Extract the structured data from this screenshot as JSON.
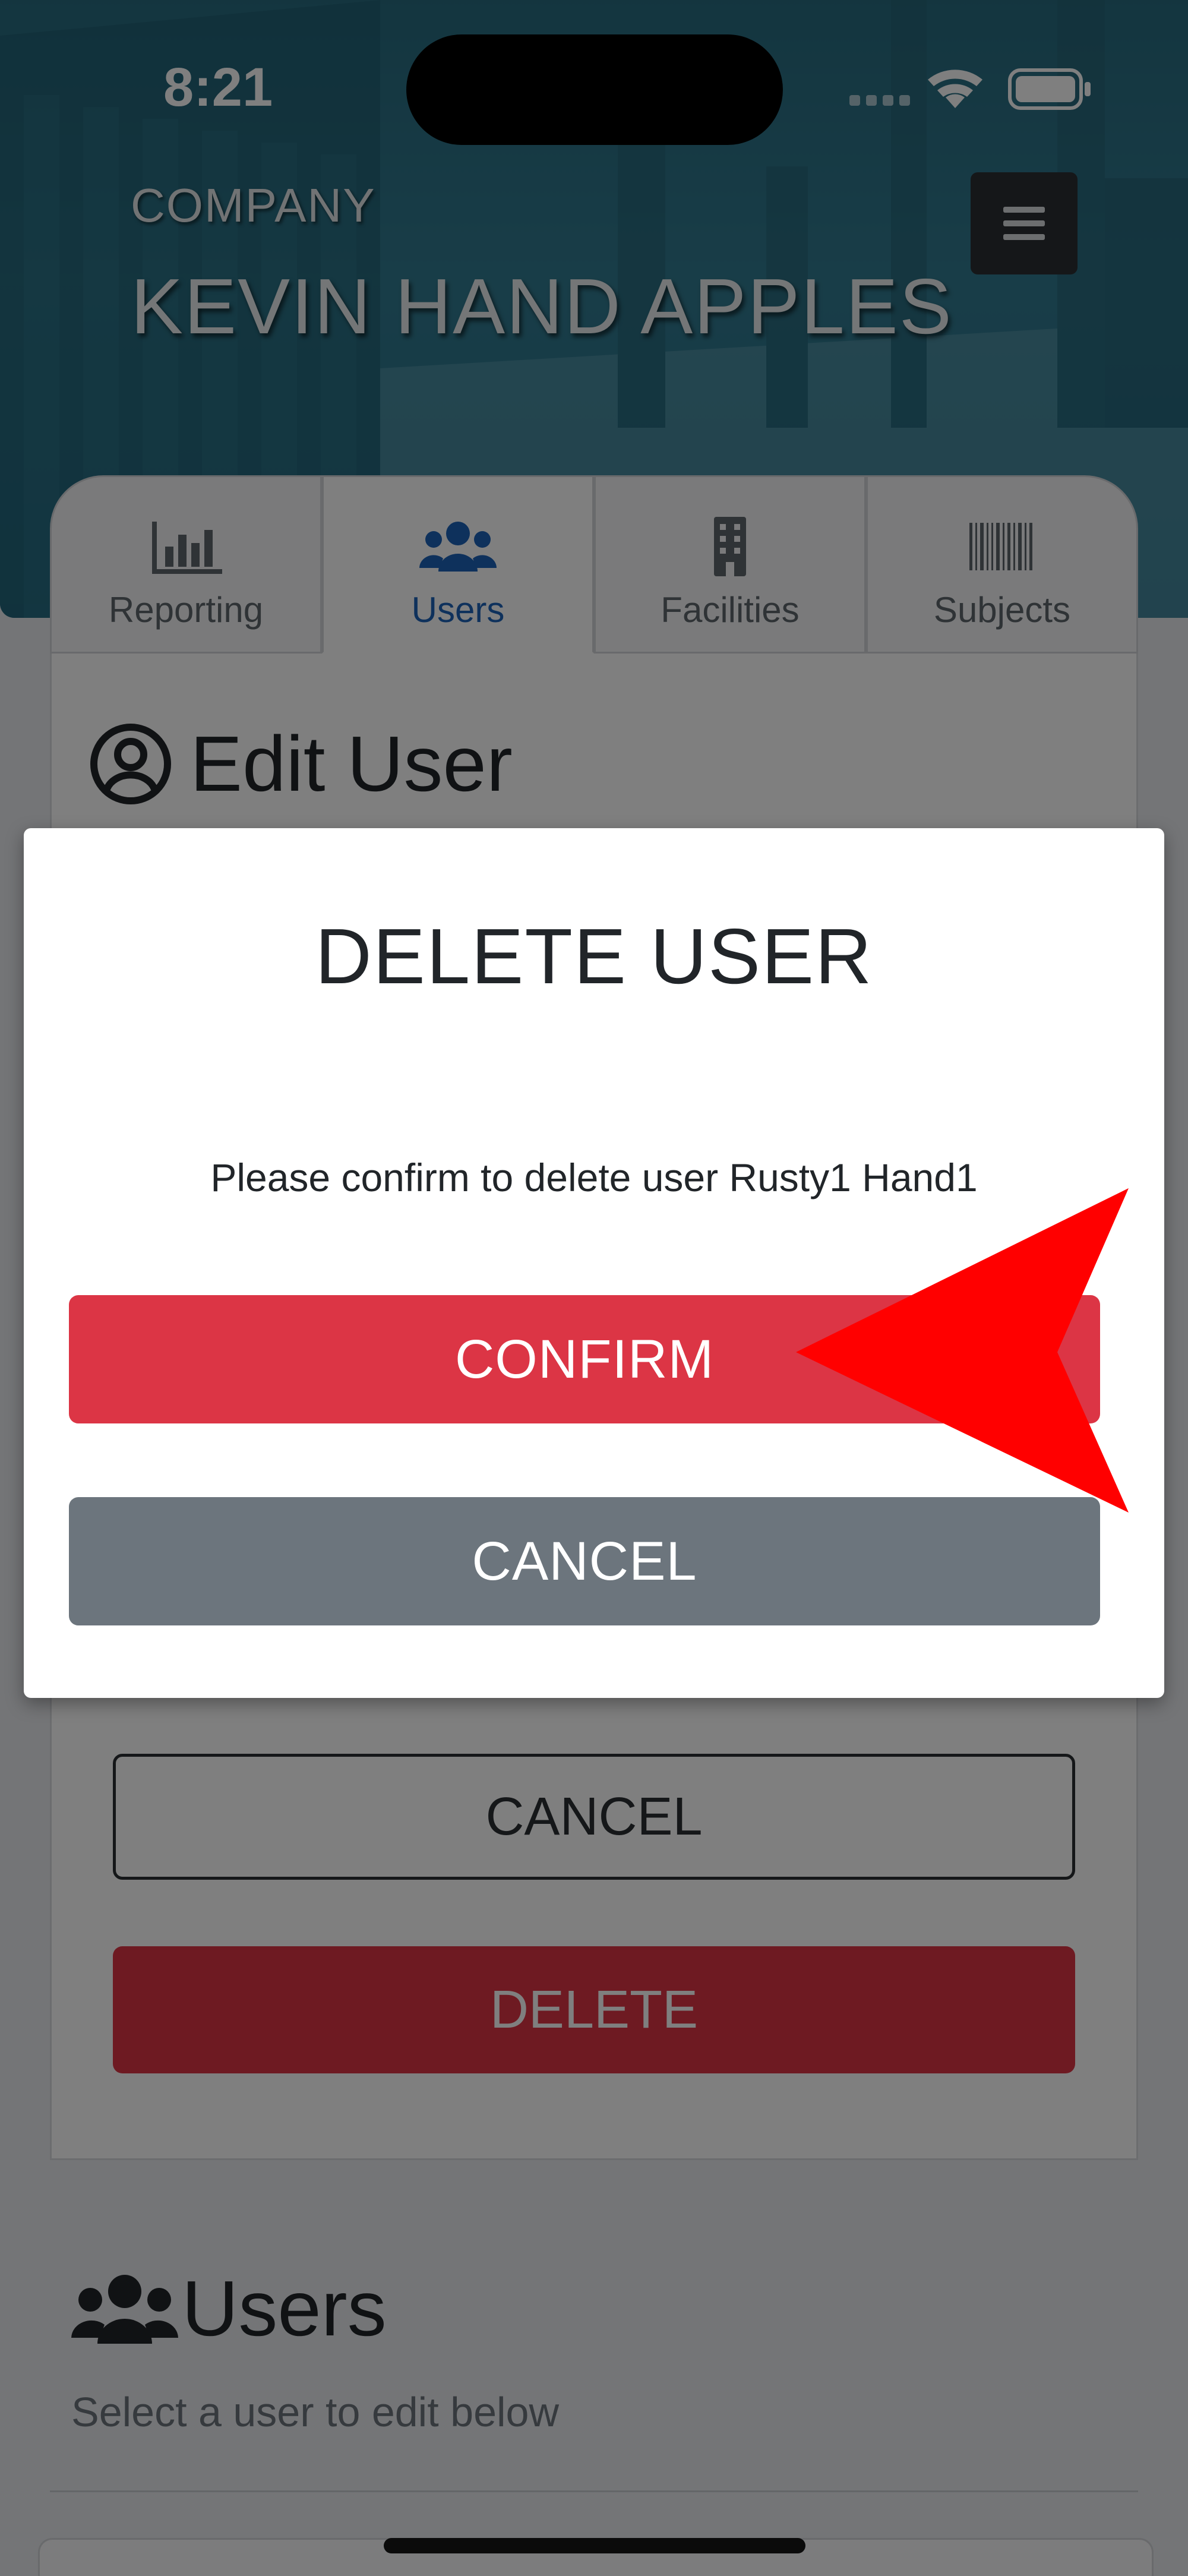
{
  "status_bar": {
    "time": "8:21"
  },
  "header": {
    "company_label": "COMPANY",
    "company_name": "KEVIN HAND APPLES",
    "menu_icon": "hamburger-icon"
  },
  "tabs": [
    {
      "label": "Reporting",
      "icon": "bar-chart-icon",
      "active": false
    },
    {
      "label": "Users",
      "icon": "users-icon",
      "active": true
    },
    {
      "label": "Facilities",
      "icon": "building-icon",
      "active": false
    },
    {
      "label": "Subjects",
      "icon": "barcode-icon",
      "active": false
    }
  ],
  "edit_user": {
    "title": "Edit User",
    "icon": "user-circle-icon",
    "cancel_label": "CANCEL",
    "delete_label": "DELETE"
  },
  "users_section": {
    "title": "Users",
    "icon": "users-icon",
    "subtitle": "Select a user to edit below"
  },
  "modal": {
    "title": "DELETE USER",
    "message": "Please confirm to delete user Rusty1 Hand1",
    "confirm_label": "CONFIRM",
    "cancel_label": "CANCEL"
  },
  "colors": {
    "danger": "#dc3545",
    "secondary": "#6c757d",
    "primary": "#1d63b8",
    "annotation_arrow": "#ff0000"
  }
}
